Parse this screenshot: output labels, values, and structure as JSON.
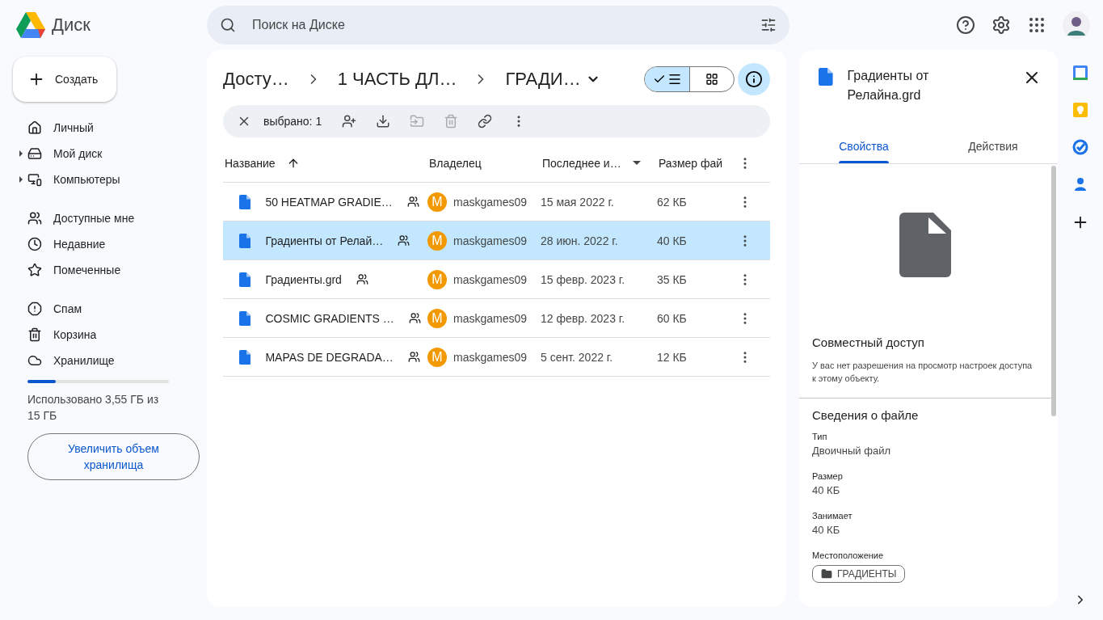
{
  "app": {
    "name": "Диск"
  },
  "search": {
    "placeholder": "Поиск на Диске"
  },
  "create_button": "Создать",
  "sidebar": {
    "groups": [
      [
        {
          "label": "Личный",
          "expandable": false
        },
        {
          "label": "Мой диск",
          "expandable": true
        },
        {
          "label": "Компьютеры",
          "expandable": true
        }
      ],
      [
        {
          "label": "Доступные мне",
          "expandable": false
        },
        {
          "label": "Недавние",
          "expandable": false
        },
        {
          "label": "Помеченные",
          "expandable": false
        }
      ],
      [
        {
          "label": "Спам",
          "expandable": false
        },
        {
          "label": "Корзина",
          "expandable": false
        },
        {
          "label": "Хранилище",
          "expandable": false
        }
      ]
    ]
  },
  "storage": {
    "level": 0.2,
    "text": "Использовано 3,55 ГБ из 15 ГБ",
    "upgrade_button": "Увеличить объем хранилища"
  },
  "breadcrumbs": [
    "Досту…",
    "1 ЧАСТЬ ДЛ…",
    "ГРАДИ…"
  ],
  "view_toggle": [
    {
      "kind": "list",
      "selected": true
    },
    {
      "kind": "grid",
      "selected": false
    }
  ],
  "info_button": {
    "selected": true
  },
  "selection_bar": {
    "count": "выбрано: 1",
    "actions": [
      {
        "kind": "share",
        "disabled": false
      },
      {
        "kind": "download",
        "disabled": false
      },
      {
        "kind": "move",
        "disabled": true
      },
      {
        "kind": "delete",
        "disabled": true
      },
      {
        "kind": "link",
        "disabled": false
      },
      {
        "kind": "more",
        "disabled": false
      }
    ]
  },
  "table": {
    "columns": [
      {
        "label": "Название",
        "kind": "sorted"
      },
      {
        "label": "Владелец",
        "kind": "plain"
      },
      {
        "label": "Последнее и…",
        "kind": "menu"
      },
      {
        "label": "Размер фай",
        "kind": "plain"
      }
    ],
    "rows": [
      {
        "name": "50 HEATMAP GRADIE…",
        "shared": true,
        "owner_initial": "M",
        "owner": "maskgames09",
        "modified": "15 мая 2022 г.",
        "size": "62 КБ",
        "selected": false
      },
      {
        "name": "Градиенты от Релай…",
        "shared": true,
        "owner_initial": "M",
        "owner": "maskgames09",
        "modified": "28 июн. 2022 г.",
        "size": "40 КБ",
        "selected": true
      },
      {
        "name": "Градиенты.grd",
        "shared": true,
        "owner_initial": "M",
        "owner": "maskgames09",
        "modified": "15 февр. 2023 г.",
        "size": "35 КБ",
        "selected": false
      },
      {
        "name": "COSMIC GRADIENTS …",
        "shared": true,
        "owner_initial": "M",
        "owner": "maskgames09",
        "modified": "12 февр. 2023 г.",
        "size": "60 КБ",
        "selected": false
      },
      {
        "name": "MAPAS DE DEGRADA…",
        "shared": true,
        "owner_initial": "M",
        "owner": "maskgames09",
        "modified": "5 сент. 2022 г.",
        "size": "12 КБ",
        "selected": false
      }
    ]
  },
  "details": {
    "title": "Градиенты от Релайна.grd",
    "tabs": [
      {
        "label": "Свойства",
        "selected": true
      },
      {
        "label": "Действия",
        "selected": false
      }
    ],
    "sharing": {
      "heading": "Совместный доступ",
      "text": "У вас нет разрешения на просмотр настроек доступа к этому объекту."
    },
    "file_info": {
      "heading": "Сведения о файле",
      "fields": [
        {
          "label": "Тип",
          "value": "Двоичный файл"
        },
        {
          "label": "Размер",
          "value": "40 КБ"
        },
        {
          "label": "Занимает",
          "value": "40 КБ"
        }
      ]
    },
    "location": {
      "label": "Местоположение",
      "chip": "ГРАДИЕНТЫ"
    }
  }
}
